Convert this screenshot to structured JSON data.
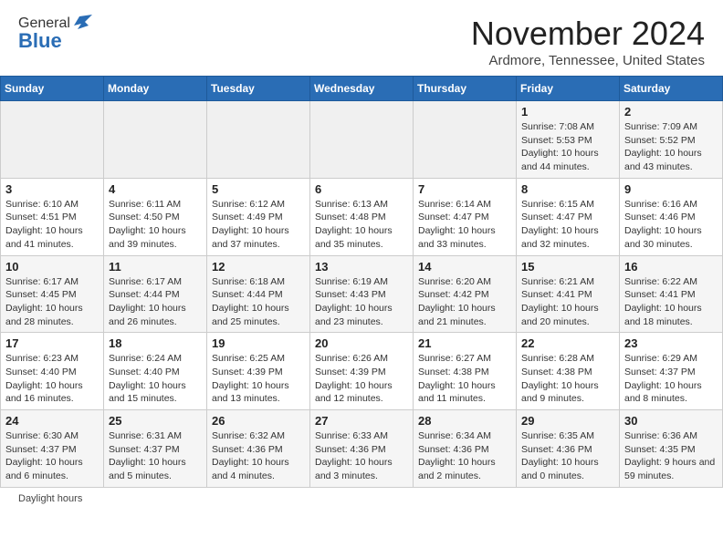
{
  "header": {
    "logo_general": "General",
    "logo_blue": "Blue",
    "month_title": "November 2024",
    "location": "Ardmore, Tennessee, United States"
  },
  "calendar": {
    "days_of_week": [
      "Sunday",
      "Monday",
      "Tuesday",
      "Wednesday",
      "Thursday",
      "Friday",
      "Saturday"
    ],
    "weeks": [
      [
        {
          "day": "",
          "info": ""
        },
        {
          "day": "",
          "info": ""
        },
        {
          "day": "",
          "info": ""
        },
        {
          "day": "",
          "info": ""
        },
        {
          "day": "",
          "info": ""
        },
        {
          "day": "1",
          "info": "Sunrise: 7:08 AM\nSunset: 5:53 PM\nDaylight: 10 hours and 44 minutes."
        },
        {
          "day": "2",
          "info": "Sunrise: 7:09 AM\nSunset: 5:52 PM\nDaylight: 10 hours and 43 minutes."
        }
      ],
      [
        {
          "day": "3",
          "info": "Sunrise: 6:10 AM\nSunset: 4:51 PM\nDaylight: 10 hours and 41 minutes."
        },
        {
          "day": "4",
          "info": "Sunrise: 6:11 AM\nSunset: 4:50 PM\nDaylight: 10 hours and 39 minutes."
        },
        {
          "day": "5",
          "info": "Sunrise: 6:12 AM\nSunset: 4:49 PM\nDaylight: 10 hours and 37 minutes."
        },
        {
          "day": "6",
          "info": "Sunrise: 6:13 AM\nSunset: 4:48 PM\nDaylight: 10 hours and 35 minutes."
        },
        {
          "day": "7",
          "info": "Sunrise: 6:14 AM\nSunset: 4:47 PM\nDaylight: 10 hours and 33 minutes."
        },
        {
          "day": "8",
          "info": "Sunrise: 6:15 AM\nSunset: 4:47 PM\nDaylight: 10 hours and 32 minutes."
        },
        {
          "day": "9",
          "info": "Sunrise: 6:16 AM\nSunset: 4:46 PM\nDaylight: 10 hours and 30 minutes."
        }
      ],
      [
        {
          "day": "10",
          "info": "Sunrise: 6:17 AM\nSunset: 4:45 PM\nDaylight: 10 hours and 28 minutes."
        },
        {
          "day": "11",
          "info": "Sunrise: 6:17 AM\nSunset: 4:44 PM\nDaylight: 10 hours and 26 minutes."
        },
        {
          "day": "12",
          "info": "Sunrise: 6:18 AM\nSunset: 4:44 PM\nDaylight: 10 hours and 25 minutes."
        },
        {
          "day": "13",
          "info": "Sunrise: 6:19 AM\nSunset: 4:43 PM\nDaylight: 10 hours and 23 minutes."
        },
        {
          "day": "14",
          "info": "Sunrise: 6:20 AM\nSunset: 4:42 PM\nDaylight: 10 hours and 21 minutes."
        },
        {
          "day": "15",
          "info": "Sunrise: 6:21 AM\nSunset: 4:41 PM\nDaylight: 10 hours and 20 minutes."
        },
        {
          "day": "16",
          "info": "Sunrise: 6:22 AM\nSunset: 4:41 PM\nDaylight: 10 hours and 18 minutes."
        }
      ],
      [
        {
          "day": "17",
          "info": "Sunrise: 6:23 AM\nSunset: 4:40 PM\nDaylight: 10 hours and 16 minutes."
        },
        {
          "day": "18",
          "info": "Sunrise: 6:24 AM\nSunset: 4:40 PM\nDaylight: 10 hours and 15 minutes."
        },
        {
          "day": "19",
          "info": "Sunrise: 6:25 AM\nSunset: 4:39 PM\nDaylight: 10 hours and 13 minutes."
        },
        {
          "day": "20",
          "info": "Sunrise: 6:26 AM\nSunset: 4:39 PM\nDaylight: 10 hours and 12 minutes."
        },
        {
          "day": "21",
          "info": "Sunrise: 6:27 AM\nSunset: 4:38 PM\nDaylight: 10 hours and 11 minutes."
        },
        {
          "day": "22",
          "info": "Sunrise: 6:28 AM\nSunset: 4:38 PM\nDaylight: 10 hours and 9 minutes."
        },
        {
          "day": "23",
          "info": "Sunrise: 6:29 AM\nSunset: 4:37 PM\nDaylight: 10 hours and 8 minutes."
        }
      ],
      [
        {
          "day": "24",
          "info": "Sunrise: 6:30 AM\nSunset: 4:37 PM\nDaylight: 10 hours and 6 minutes."
        },
        {
          "day": "25",
          "info": "Sunrise: 6:31 AM\nSunset: 4:37 PM\nDaylight: 10 hours and 5 minutes."
        },
        {
          "day": "26",
          "info": "Sunrise: 6:32 AM\nSunset: 4:36 PM\nDaylight: 10 hours and 4 minutes."
        },
        {
          "day": "27",
          "info": "Sunrise: 6:33 AM\nSunset: 4:36 PM\nDaylight: 10 hours and 3 minutes."
        },
        {
          "day": "28",
          "info": "Sunrise: 6:34 AM\nSunset: 4:36 PM\nDaylight: 10 hours and 2 minutes."
        },
        {
          "day": "29",
          "info": "Sunrise: 6:35 AM\nSunset: 4:36 PM\nDaylight: 10 hours and 0 minutes."
        },
        {
          "day": "30",
          "info": "Sunrise: 6:36 AM\nSunset: 4:35 PM\nDaylight: 9 hours and 59 minutes."
        }
      ]
    ]
  },
  "legend": {
    "daylight_hours": "Daylight hours"
  }
}
